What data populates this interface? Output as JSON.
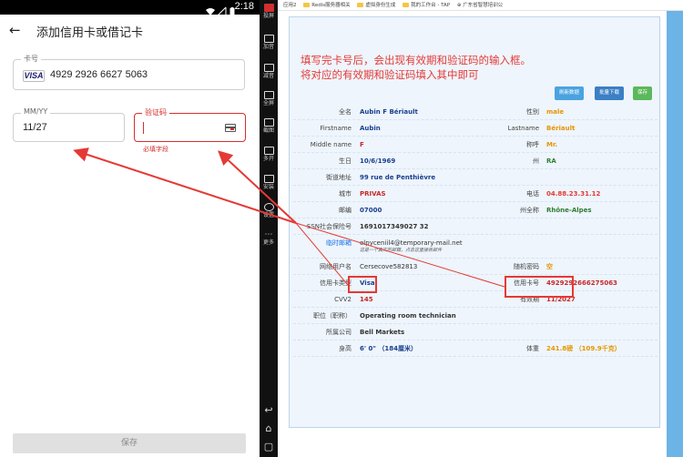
{
  "phone": {
    "clock": "2:18",
    "title": "添加信用卡或借记卡",
    "card_label": "卡号",
    "card_brand": "VISA",
    "card_number": "4929 2926 6627 5063",
    "exp_label": "MM/YY",
    "exp_value": "11/27",
    "cvv_label": "验证码",
    "required_text": "必填字段",
    "save_label": "保存"
  },
  "sidebar": {
    "items": [
      "投屏",
      "加音",
      "减音",
      "全屏",
      "截图",
      "多开",
      "安装",
      "设置",
      "更多"
    ]
  },
  "browser": {
    "bookmarks": [
      "应用2",
      "Redis服务器相关",
      "虚拟身份生成",
      "我的工作台 - TAP",
      "广东省智慧培训公"
    ],
    "note_line1": "填写完卡号后，会出现有效期和验证码的输入框。",
    "note_line2": "将对应的有效期和验证码填入其中即可",
    "btn_refresh": "刷新数据",
    "btn_download": "批量下载",
    "btn_save": "保存",
    "fields": {
      "fullname_label": "全名",
      "fullname": "Aubin F Bériault",
      "gender_label": "性别",
      "gender": "male",
      "firstname_label": "Firstname",
      "firstname": "Aubin",
      "lastname_label": "Lastname",
      "lastname": "Bériault",
      "middlename_label": "Middle name",
      "middlename": "F",
      "title_label": "称呼",
      "title": "Mr.",
      "birthday_label": "生日",
      "birthday": "10/6/1969",
      "state_label": "州",
      "state": "RA",
      "street_label": "街道地址",
      "street": "99 rue de Penthièvre",
      "city_label": "城市",
      "city": "PRIVAS",
      "phone_label": "电话",
      "phone": "04.88.23.31.12",
      "zip_label": "邮编",
      "zip": "07000",
      "statefull_label": "州全称",
      "statefull": "Rhône-Alpes",
      "ssn_label": "SSN社会保险号",
      "ssn": "1691017349027 32",
      "email_label": "临时邮箱",
      "email": "elpyceniil4@temporary-mail.net",
      "email_hint": "这是一个真实的邮箱，点击这里",
      "email_hint_link": "这里",
      "email_hint_tail": "接收邮件",
      "username_label": "网络用户名",
      "username": "Cersecove582813",
      "password_label": "随机密码",
      "password": "空",
      "cardtype_label": "信用卡类型",
      "cardtype": "Visa",
      "cardno_label": "信用卡号",
      "cardno": "4929292666275063",
      "cvv_label": "CVV2",
      "cvv": "145",
      "expiry_label": "有效期",
      "expiry": "11/2027",
      "job_label": "职位（职称）",
      "job": "Operating room technician",
      "company_label": "所属公司",
      "company": "Bell Markets",
      "height_label": "身高",
      "height": "6' 0\" （184厘米）",
      "weight_label": "体重",
      "weight": "241.8磅 （109.9千克）"
    }
  },
  "colors": {
    "accent_red": "#e53935",
    "panel_bg": "#eef5fc",
    "value_blue": "#1a3f8f",
    "value_red": "#c62828",
    "value_green": "#2e7d32",
    "value_orange": "#e69500"
  }
}
